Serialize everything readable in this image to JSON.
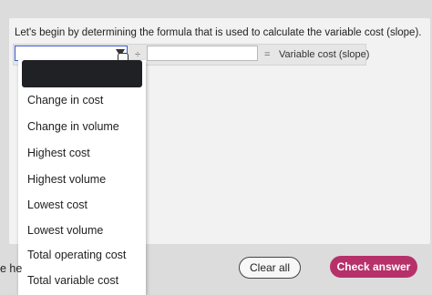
{
  "instruction": "Let's begin by determining the formula that is used to calculate the variable cost (slope).",
  "formula": {
    "operator": "÷",
    "equals": "=",
    "result_label": "Variable cost (slope)"
  },
  "dropdown_options": [
    "Change in cost",
    "Change in volume",
    "Highest cost",
    "Highest volume",
    "Lowest cost",
    "Lowest volume",
    "Total operating cost",
    "Total variable cost"
  ],
  "partial_text": "e he",
  "buttons": {
    "clear": "Clear all",
    "check": "Check answer"
  },
  "colors": {
    "check_button": "#b6316a",
    "select_border": "#3b5bd6"
  }
}
